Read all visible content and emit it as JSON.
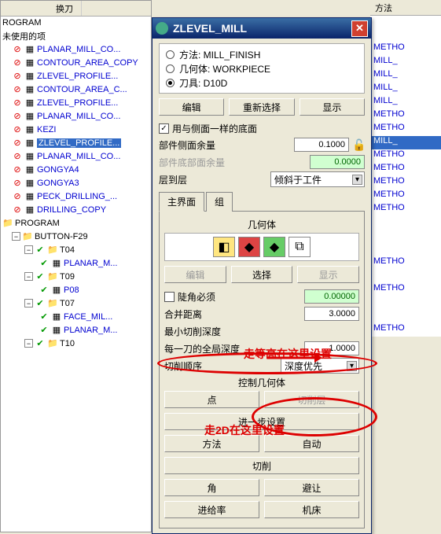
{
  "tree": {
    "headers": [
      "换刀",
      "方法"
    ],
    "root": "ROGRAM",
    "unused": "未使用的项",
    "items": [
      {
        "label": "PLANAR_MILL_CO...",
        "method": "METHO"
      },
      {
        "label": "CONTOUR_AREA_COPY",
        "method": "MILL_"
      },
      {
        "label": "ZLEVEL_PROFILE...",
        "method": "MILL_"
      },
      {
        "label": "CONTOUR_AREA_C...",
        "method": "MILL_"
      },
      {
        "label": "ZLEVEL_PROFILE...",
        "method": "MILL_"
      },
      {
        "label": "PLANAR_MILL_CO...",
        "method": "METHO"
      },
      {
        "label": "KEZI",
        "method": "METHO"
      },
      {
        "label": "ZLEVEL_PROFILE...",
        "method": "MILL_",
        "selected": true
      },
      {
        "label": "PLANAR_MILL_CO...",
        "method": "METHO"
      },
      {
        "label": "GONGYA4",
        "method": "METHO"
      },
      {
        "label": "GONGYA3",
        "method": "METHO"
      },
      {
        "label": "PECK_DRILLING_...",
        "method": "METHO"
      },
      {
        "label": "DRILLING_COPY",
        "method": "METHO"
      }
    ],
    "program": "PROGRAM",
    "buttonNode": "BUTTON-F29",
    "subgroups": [
      {
        "name": "T04",
        "children": [
          "PLANAR_M..."
        ],
        "method": "METHO"
      },
      {
        "name": "T09",
        "children": [
          "P08"
        ],
        "method": "METHO"
      },
      {
        "name": "T07",
        "children": [
          "FACE_MIL...",
          "PLANAR_M..."
        ],
        "method": "METHO"
      },
      {
        "name": "T10"
      }
    ]
  },
  "methodHeader": "方法",
  "dialog": {
    "title": "ZLEVEL_MILL",
    "options": [
      {
        "label": "方法: MILL_FINISH",
        "checked": false
      },
      {
        "label": "几何体: WORKPIECE",
        "checked": false
      },
      {
        "label": "刀具: D10D",
        "checked": true
      }
    ],
    "topButtons": [
      "编辑",
      "重新选择",
      "显示"
    ],
    "useSameBottom": {
      "label": "用与侧面一样的底面",
      "checked": true
    },
    "sideAllowanceLabel": "部件侧面余量",
    "sideAllowanceValue": "0.1000",
    "bottomAllowanceLabel": "部件底部面余量",
    "bottomAllowanceValue": "0.0000",
    "layerToLayerLabel": "层到层",
    "layerToLayerValue": "倾斜于工件",
    "tabs": [
      "主界面",
      "组"
    ],
    "geometryLabel": "几何体",
    "geoButtons": [
      "编辑",
      "选择",
      "显示"
    ],
    "steepRequired": {
      "label": "陡角必须",
      "value": "0.00000"
    },
    "mergeDistLabel": "合并距离",
    "mergeDistValue": "3.0000",
    "minCutDepthLabel": "最小切削深度",
    "minCutDepthValue": "走等高在这里设置",
    "globalDepthLabel": "每一刀的全局深度",
    "globalDepthValue": "1.0000",
    "cutOrderLabel": "切削顺序",
    "cutOrderValue": "深度优先",
    "controlGeomLabel": "控制几何体",
    "pointBtn": "点",
    "cutLayerBtn": "切削层",
    "moreBtn": "走2D在这里设置",
    "bottomRows": [
      [
        "方法",
        "自动"
      ],
      [
        "切削"
      ],
      [
        "角",
        "避让"
      ],
      [
        "进给率",
        "机床"
      ]
    ]
  },
  "annotations": {
    "ann1": "走等高在这里设置",
    "ann2": "走2D在这里设置"
  }
}
